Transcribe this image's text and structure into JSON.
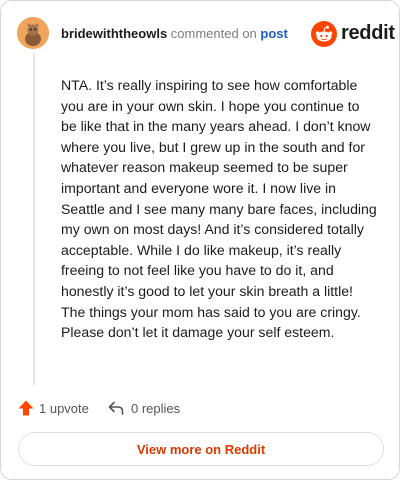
{
  "header": {
    "username": "bridewiththeowls",
    "action_text": "commented on",
    "link_text": "post",
    "brand_name": "reddit"
  },
  "comment": {
    "body": "NTA. It’s really inspiring to see how comfortable you are in your own skin. I hope you continue to be like that in the many years ahead. I don’t know where you live, but I grew up in the south and for whatever reason makeup seemed to be super important and everyone wore it. I now live in Seattle and I see many many bare faces, including my own on most days! And it’s considered totally acceptable. While I do like makeup, it’s really freeing to not feel like you have to do it, and honestly it’s good to let your skin breath a little! The things your mom has said to you are cringy. Please don’t let it damage your self esteem."
  },
  "actions": {
    "upvote_label": "1 upvote",
    "replies_label": "0 replies"
  },
  "footer": {
    "view_more_label": "View more on Reddit"
  },
  "icons": {
    "avatar": "avatar-icon",
    "brand": "reddit-logo-icon",
    "upvote": "upvote-arrow-icon",
    "reply": "reply-arrow-icon"
  },
  "colors": {
    "accent": "#d93a00",
    "upvote": "#ff4500",
    "link": "#1c5ec8",
    "avatar_bg": "#f1a45c"
  }
}
